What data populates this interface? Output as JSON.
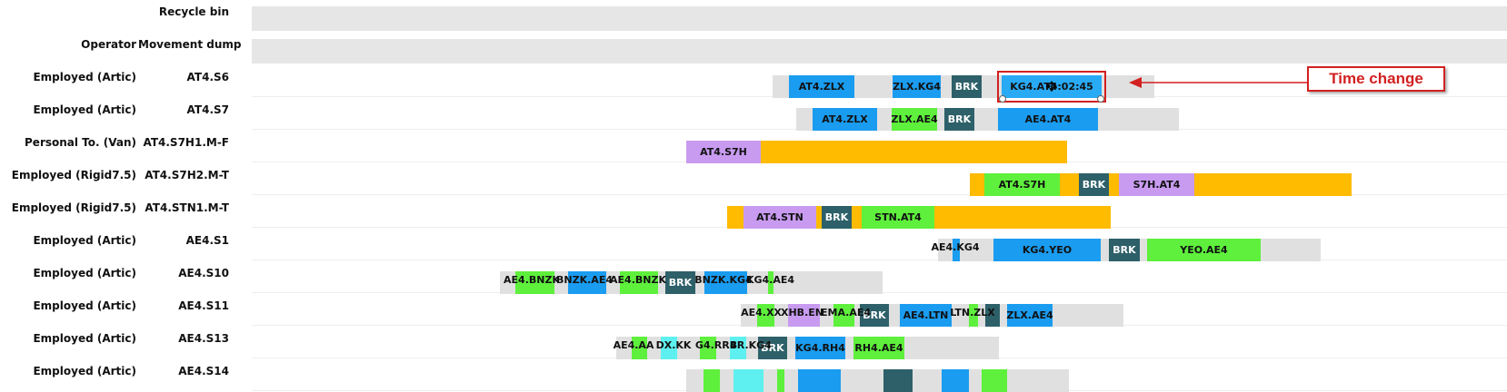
{
  "colors": {
    "route_blue": "#1a9cf0",
    "route_blue_light": "#29aaf5",
    "break_teal": "#2d6069",
    "green": "#5ef03c",
    "lavender": "#c89bf0",
    "amber": "#ffbb00",
    "cyan": "#5ef0f0",
    "idle_gray": "#e0e0e0",
    "annotation_red": "#d32020"
  },
  "annotation": {
    "label": "Time change"
  },
  "rows": [
    {
      "type": "",
      "name": "Recycle bin",
      "track": "gray",
      "segments": []
    },
    {
      "type": "Operator",
      "name": "Movement dump",
      "track": "gray",
      "segments": []
    },
    {
      "type": "Employed (Artic)",
      "name": "AT4.S6",
      "track": "plain",
      "segments": [
        {
          "label": "",
          "color": "idle_gray",
          "start": 850,
          "end": 1270
        },
        {
          "label": "AT4.ZLX",
          "color": "route_blue",
          "start": 868,
          "end": 940
        },
        {
          "label": "ZLX.KG4",
          "color": "route_blue",
          "start": 982,
          "end": 1035
        },
        {
          "label": "BRK",
          "color": "break_teal",
          "start": 1047,
          "end": 1080
        },
        {
          "label": "KG4.AT4:02:45",
          "color": "route_blue_light",
          "start": 1102,
          "end": 1212,
          "selected": true
        }
      ]
    },
    {
      "type": "Employed (Artic)",
      "name": "AT4.S7",
      "track": "plain",
      "segments": [
        {
          "label": "",
          "color": "idle_gray",
          "start": 876,
          "end": 1297
        },
        {
          "label": "AT4.ZLX",
          "color": "route_blue",
          "start": 894,
          "end": 965
        },
        {
          "label": "ZLX.AE4",
          "color": "green",
          "start": 981,
          "end": 1031
        },
        {
          "label": "BRK",
          "color": "break_teal",
          "start": 1039,
          "end": 1072
        },
        {
          "label": "AE4.AT4",
          "color": "route_blue",
          "start": 1098,
          "end": 1208
        }
      ]
    },
    {
      "type": "Personal To. (Van)",
      "name": "AT4.S7H1.M-F",
      "track": "plain",
      "segments": [
        {
          "label": "AT4.S7H",
          "color": "lavender",
          "start": 755,
          "end": 837
        },
        {
          "label": "",
          "color": "amber",
          "start": 837,
          "end": 1174
        }
      ]
    },
    {
      "type": "Employed (Rigid7.5)",
      "name": "AT4.S7H2.M-T",
      "track": "plain",
      "segments": [
        {
          "label": "",
          "color": "amber",
          "start": 1067,
          "end": 1487
        },
        {
          "label": "AT4.S7H",
          "color": "green",
          "start": 1083,
          "end": 1166
        },
        {
          "label": "BRK",
          "color": "break_teal",
          "start": 1187,
          "end": 1220
        },
        {
          "label": "S7H.AT4",
          "color": "lavender",
          "start": 1231,
          "end": 1314
        }
      ]
    },
    {
      "type": "Employed (Rigid7.5)",
      "name": "AT4.STN1.M-T",
      "track": "plain",
      "segments": [
        {
          "label": "",
          "color": "amber",
          "start": 800,
          "end": 1222
        },
        {
          "label": "AT4.STN",
          "color": "lavender",
          "start": 818,
          "end": 898
        },
        {
          "label": "BRK",
          "color": "break_teal",
          "start": 904,
          "end": 937
        },
        {
          "label": "STN.AT4",
          "color": "green",
          "start": 948,
          "end": 1028
        }
      ]
    },
    {
      "type": "Employed (Artic)",
      "name": "AE4.S1",
      "track": "plain",
      "segments": [
        {
          "label": "",
          "color": "idle_gray",
          "start": 1032,
          "end": 1453
        },
        {
          "label": "",
          "color": "route_blue",
          "start": 1048,
          "end": 1056
        },
        {
          "label": "AE4.KG4",
          "color": "",
          "start": 1022,
          "end": 1080
        },
        {
          "label": "KG4.YEO",
          "color": "route_blue",
          "start": 1093,
          "end": 1211
        },
        {
          "label": "BRK",
          "color": "break_teal",
          "start": 1220,
          "end": 1254
        },
        {
          "label": "YEO.AE4",
          "color": "green",
          "start": 1262,
          "end": 1387
        }
      ]
    },
    {
      "type": "Employed (Artic)",
      "name": "AE4.S10",
      "track": "plain",
      "segments": [
        {
          "label": "",
          "color": "idle_gray",
          "start": 550,
          "end": 971
        },
        {
          "label": "",
          "color": "green",
          "start": 567,
          "end": 610
        },
        {
          "label": "",
          "color": "route_blue",
          "start": 625,
          "end": 667
        },
        {
          "label": "",
          "color": "green",
          "start": 682,
          "end": 724
        },
        {
          "label": "BRK",
          "color": "break_teal",
          "start": 732,
          "end": 765
        },
        {
          "label": "",
          "color": "route_blue",
          "start": 775,
          "end": 822
        },
        {
          "label": "",
          "color": "green",
          "start": 845,
          "end": 851
        },
        {
          "label": "AE4.BNZK",
          "color": "",
          "start": 556,
          "end": 614
        },
        {
          "label": "BNZK.AE4",
          "color": "",
          "start": 614,
          "end": 672
        },
        {
          "label": "AE4.BNZK",
          "color": "",
          "start": 672,
          "end": 732
        },
        {
          "label": "BNZK.KG4",
          "color": "",
          "start": 770,
          "end": 822
        },
        {
          "label": "KG4.AE4",
          "color": "",
          "start": 820,
          "end": 875
        }
      ]
    },
    {
      "type": "Employed (Artic)",
      "name": "AE4.S11",
      "track": "plain",
      "segments": [
        {
          "label": "",
          "color": "idle_gray",
          "start": 815,
          "end": 1236
        },
        {
          "label": "",
          "color": "green",
          "start": 833,
          "end": 852
        },
        {
          "label": "",
          "color": "lavender",
          "start": 867,
          "end": 902
        },
        {
          "label": "",
          "color": "green",
          "start": 917,
          "end": 940
        },
        {
          "label": "BRK",
          "color": "break_teal",
          "start": 946,
          "end": 978
        },
        {
          "label": "AE4.LTN",
          "color": "route_blue",
          "start": 990,
          "end": 1047
        },
        {
          "label": "",
          "color": "green",
          "start": 1066,
          "end": 1076
        },
        {
          "label": "",
          "color": "break_teal",
          "start": 1084,
          "end": 1100
        },
        {
          "label": "ZLX.AE4",
          "color": "route_blue",
          "start": 1108,
          "end": 1158
        },
        {
          "label": "AE4.XX",
          "color": "",
          "start": 815,
          "end": 860
        },
        {
          "label": "XHB.EN",
          "color": "",
          "start": 857,
          "end": 908
        },
        {
          "label": "EMA.AE4",
          "color": "",
          "start": 903,
          "end": 958
        },
        {
          "label": "LTN.ZLX",
          "color": "",
          "start": 1042,
          "end": 1098
        }
      ]
    },
    {
      "type": "Employed (Artic)",
      "name": "AE4.S13",
      "track": "plain",
      "segments": [
        {
          "label": "",
          "color": "idle_gray",
          "start": 678,
          "end": 1099
        },
        {
          "label": "",
          "color": "green",
          "start": 695,
          "end": 712
        },
        {
          "label": "",
          "color": "cyan",
          "start": 727,
          "end": 745
        },
        {
          "label": "",
          "color": "green",
          "start": 770,
          "end": 788
        },
        {
          "label": "",
          "color": "cyan",
          "start": 803,
          "end": 821
        },
        {
          "label": "BRK",
          "color": "break_teal",
          "start": 834,
          "end": 866
        },
        {
          "label": "KG4.RH4",
          "color": "route_blue",
          "start": 875,
          "end": 930
        },
        {
          "label": "RH4.AE4",
          "color": "green",
          "start": 939,
          "end": 995
        },
        {
          "label": "AE4.AA",
          "color": "",
          "start": 676,
          "end": 718
        },
        {
          "label": "DX.KK",
          "color": "",
          "start": 718,
          "end": 764
        },
        {
          "label": "G4.RRB",
          "color": "",
          "start": 764,
          "end": 812
        },
        {
          "label": "4R.KG4",
          "color": "",
          "start": 800,
          "end": 852
        }
      ]
    },
    {
      "type": "Employed (Artic)",
      "name": "AE4.S14",
      "track": "plain",
      "segments": [
        {
          "label": "",
          "color": "idle_gray",
          "start": 755,
          "end": 1176
        },
        {
          "label": "",
          "color": "green",
          "start": 774,
          "end": 792
        },
        {
          "label": "",
          "color": "cyan",
          "start": 807,
          "end": 840
        },
        {
          "label": "",
          "color": "green",
          "start": 855,
          "end": 863
        },
        {
          "label": "",
          "color": "route_blue",
          "start": 878,
          "end": 925
        },
        {
          "label": "",
          "color": "break_teal",
          "start": 972,
          "end": 1004
        },
        {
          "label": "",
          "color": "route_blue",
          "start": 1036,
          "end": 1066
        },
        {
          "label": "",
          "color": "green",
          "start": 1080,
          "end": 1108
        }
      ]
    }
  ]
}
